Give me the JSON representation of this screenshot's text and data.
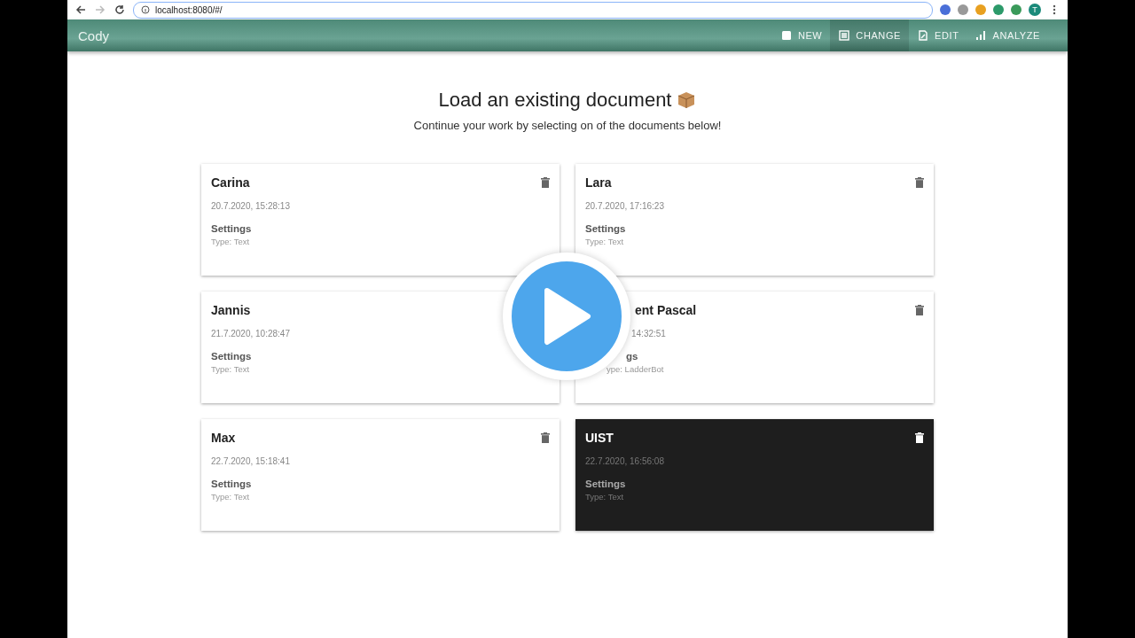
{
  "browser": {
    "url": "localhost:8080/#/",
    "forward_disabled": true,
    "profile_initial": "T"
  },
  "app_bar": {
    "title": "Cody",
    "actions": [
      {
        "label": "NEW",
        "selected": false
      },
      {
        "label": "CHANGE",
        "selected": true
      },
      {
        "label": "EDIT",
        "selected": false
      },
      {
        "label": "ANALYZE",
        "selected": false
      }
    ]
  },
  "heading": "Load an existing document",
  "subheading": "Continue your work by selecting on of the documents below!",
  "documents": [
    {
      "kind": "full",
      "name": "Carina",
      "date": "20.7.2020, 15:28:13",
      "settings": "Settings",
      "type": "Type: Text",
      "selected": false,
      "delete_shown": true
    },
    {
      "kind": "full",
      "name": "Lara",
      "date": "20.7.2020, 17:16:23",
      "settings": "Settings",
      "type": "Type: Text",
      "selected": false,
      "delete_shown": true
    },
    {
      "kind": "full",
      "name": "Jannis",
      "date": "21.7.2020, 10:28:47",
      "settings": "Settings",
      "type": "Type: Text",
      "selected": false,
      "delete_shown": false
    },
    {
      "kind": "overlaid",
      "name": "ent Pascal",
      "date": "14:32:51",
      "settings": "gs",
      "type": "ype: LadderBot",
      "selected": false,
      "delete_shown": true
    },
    {
      "kind": "full",
      "name": "Max",
      "date": "22.7.2020, 15:18:41",
      "settings": "Settings",
      "type": "Type: Text",
      "selected": false,
      "delete_shown": true
    },
    {
      "kind": "full",
      "name": "UIST",
      "date": "22.7.2020, 16:56:08",
      "settings": "Settings",
      "type": "Type: Text",
      "selected": true,
      "delete_shown": true
    }
  ]
}
